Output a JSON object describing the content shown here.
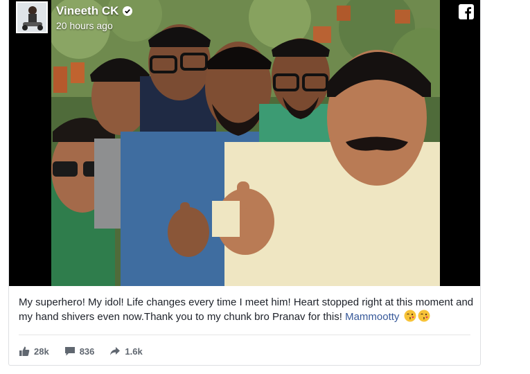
{
  "post": {
    "author": "Vineeth CK",
    "time": "20 hours ago",
    "caption_text": "My superhero! My idol! Life changes every time I meet him! Heart stopped right at this moment and my hand shivers even now.Thank you to my chunk bro Pranav for this! ",
    "mention": "Mammootty",
    "emojis": [
      "kissing-face-emoji",
      "kissing-face-emoji"
    ]
  },
  "stats": {
    "likes": "28k",
    "comments": "836",
    "shares": "1.6k"
  },
  "icons": {
    "verified": "verified-badge-icon",
    "platform": "facebook-logo-icon",
    "like": "thumbs-up-icon",
    "comment": "comment-icon",
    "share": "share-arrow-icon"
  },
  "colors": {
    "media_background": "#000000",
    "text": "#1d2129",
    "mention": "#365899",
    "meta": "#606770"
  }
}
